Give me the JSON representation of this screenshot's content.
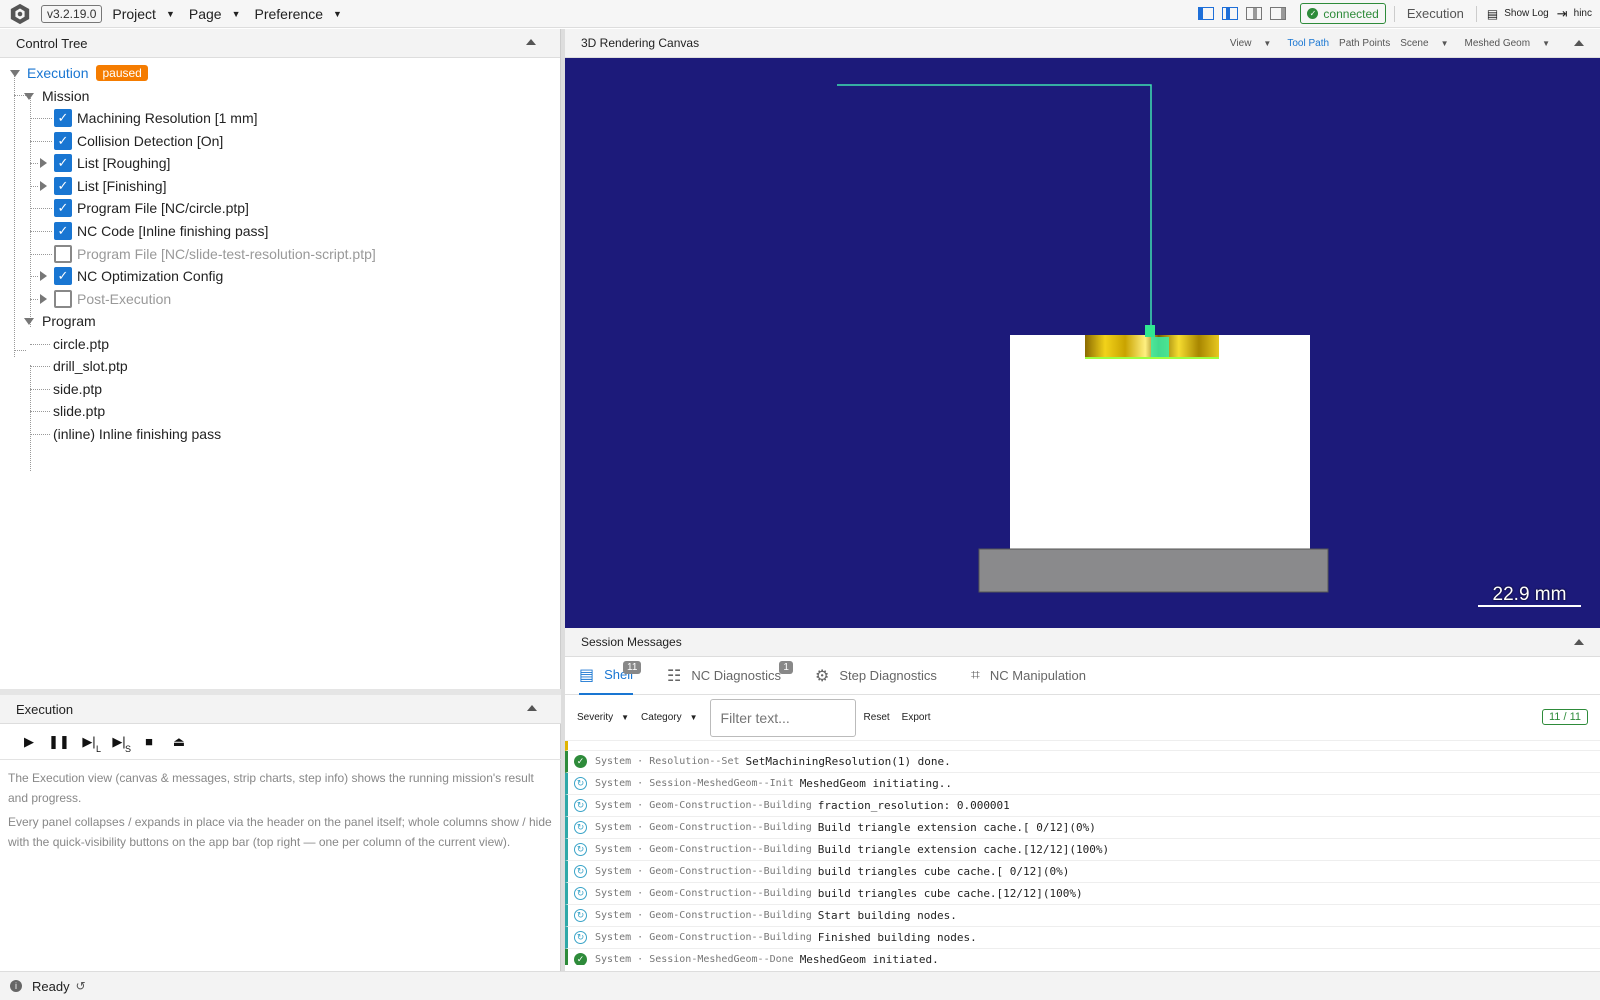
{
  "appbar": {
    "version": "v3.2.19.0",
    "menus": [
      "Project",
      "Page",
      "Preference"
    ],
    "connection": "connected",
    "current_view": "Execution",
    "show_log": "Show Log",
    "user": "hinc",
    "colors": {
      "accent": "#1976d2",
      "connected": "#2e8b3a"
    }
  },
  "control_tree": {
    "title": "Control Tree",
    "execution_label": "Execution",
    "execution_state": "paused",
    "mission_label": "Mission",
    "mission_items": [
      {
        "label": "Machining Resolution [1 mm]",
        "checked": true
      },
      {
        "label": "Collision Detection [On]",
        "checked": true
      },
      {
        "label": "List [Roughing]",
        "checked": true
      },
      {
        "label": "List [Finishing]",
        "checked": true
      },
      {
        "label": "Program File [NC/circle.ptp]",
        "checked": true
      },
      {
        "label": "NC Code [Inline finishing pass]",
        "checked": true
      },
      {
        "label": "Program File [NC/slide-test-resolution-script.ptp]",
        "checked": false
      },
      {
        "label": "NC Optimization Config",
        "checked": true
      },
      {
        "label": "Post-Execution",
        "checked": false
      }
    ],
    "program_label": "Program",
    "program_items": [
      "circle.ptp",
      "drill_slot.ptp",
      "side.ptp",
      "slide.ptp",
      "(inline) Inline finishing pass"
    ]
  },
  "execution": {
    "title": "Execution",
    "toolbar_icons": [
      "play-icon",
      "pause-icon",
      "step-line-icon",
      "step-segment-icon",
      "stop-icon",
      "eject-icon"
    ],
    "step_line_sub": "L",
    "step_segment_sub": "S",
    "help_1": "The Execution view (canvas & messages, strip charts, step info) shows the running mission's result and progress.",
    "help_2": "Every panel collapses / expands in place via the header on the panel itself; whole columns show / hide with the quick-visibility buttons on the app bar (top right — one per column of the current view)."
  },
  "canvas": {
    "title": "3D Rendering Canvas",
    "toolbar": {
      "view": "View",
      "tool_path": "Tool Path",
      "path_points": "Path Points",
      "scene": "Scene",
      "meshed_geom": "Meshed Geom"
    },
    "scale_label": "22.9 mm",
    "background": "#1c1a7a"
  },
  "session_messages": {
    "title": "Session Messages",
    "tabs": [
      {
        "label": "Shell",
        "count": "11"
      },
      {
        "label": "NC Diagnostics",
        "count": "1"
      },
      {
        "label": "Step Diagnostics",
        "count": ""
      },
      {
        "label": "NC Manipulation",
        "count": ""
      }
    ],
    "filter": {
      "severity": "Severity",
      "category": "Category",
      "placeholder": "Filter text...",
      "reset": "Reset",
      "export": "Export",
      "count": "11 / 11"
    },
    "messages": [
      {
        "status": "ok",
        "source": "System",
        "category": "Resolution--Set",
        "text": "SetMachiningResolution(1) done."
      },
      {
        "status": "busy",
        "source": "System",
        "category": "Session-MeshedGeom--Init",
        "text": "MeshedGeom initiating.."
      },
      {
        "status": "busy",
        "source": "System",
        "category": "Geom-Construction--Building",
        "text": "fraction_resolution: 0.000001"
      },
      {
        "status": "busy",
        "source": "System",
        "category": "Geom-Construction--Building",
        "text": "Build triangle extension cache.[ 0/12](0%)"
      },
      {
        "status": "busy",
        "source": "System",
        "category": "Geom-Construction--Building",
        "text": "Build triangle extension cache.[12/12](100%)"
      },
      {
        "status": "busy",
        "source": "System",
        "category": "Geom-Construction--Building",
        "text": "build triangles cube cache.[ 0/12](0%)"
      },
      {
        "status": "busy",
        "source": "System",
        "category": "Geom-Construction--Building",
        "text": "build triangles cube cache.[12/12](100%)"
      },
      {
        "status": "busy",
        "source": "System",
        "category": "Geom-Construction--Building",
        "text": "Start building nodes."
      },
      {
        "status": "busy",
        "source": "System",
        "category": "Geom-Construction--Building",
        "text": "Finished building nodes."
      },
      {
        "status": "ok",
        "source": "System",
        "category": "Session-MeshedGeom--Done",
        "text": "MeshedGeom initiated."
      }
    ]
  },
  "status_bar": {
    "text": "Ready"
  }
}
